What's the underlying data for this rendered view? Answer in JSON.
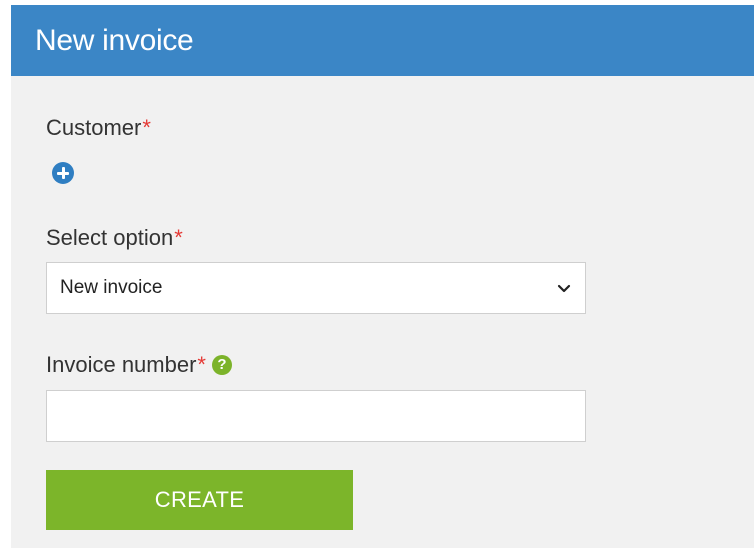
{
  "header": {
    "title": "New invoice"
  },
  "form": {
    "customer": {
      "label": "Customer",
      "required_mark": "*",
      "add_icon": "plus-circle-icon"
    },
    "option": {
      "label": "Select option",
      "required_mark": "*",
      "selected_value": "New invoice",
      "dropdown_icon": "chevron-down-icon"
    },
    "invoice_number": {
      "label": "Invoice number",
      "required_mark": "*",
      "help_glyph": "?",
      "value": ""
    },
    "create_label": "CREATE"
  },
  "colors": {
    "header_bg": "#3b86c6",
    "panel_bg": "#f1f1f1",
    "required": "#e53935",
    "add_icon": "#2f7ec2",
    "help_icon": "#7cb32a",
    "create_button": "#7cb52a"
  }
}
